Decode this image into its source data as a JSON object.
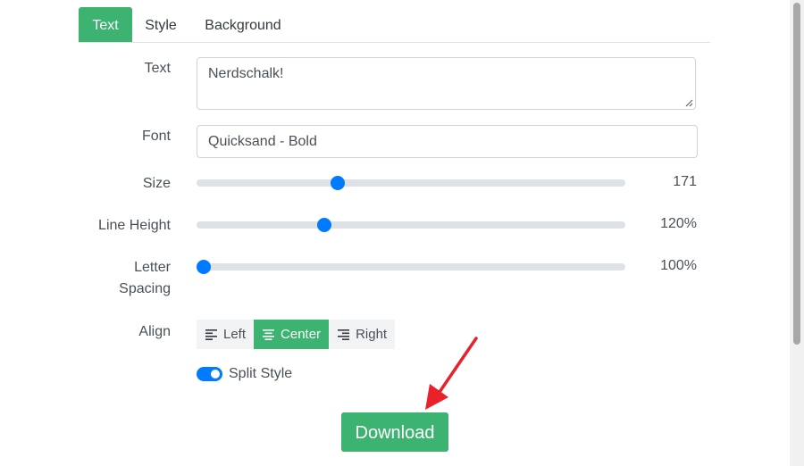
{
  "tabs": [
    {
      "label": "Text",
      "active": true
    },
    {
      "label": "Style",
      "active": false
    },
    {
      "label": "Background",
      "active": false
    }
  ],
  "form": {
    "text": {
      "label": "Text",
      "value": "Nerdschalk!"
    },
    "font": {
      "label": "Font",
      "value": "Quicksand - Bold"
    },
    "size": {
      "label": "Size",
      "value": "171",
      "position_fraction": 0.323
    },
    "line_height": {
      "label": "Line Height",
      "value": "120%",
      "position_fraction": 0.29
    },
    "letter_spacing": {
      "label_line1": "Letter",
      "label_line2": "Spacing",
      "value": "100%",
      "position_fraction": 0.0
    },
    "align": {
      "label": "Align",
      "options": [
        {
          "label": "Left",
          "icon": "align-left-icon",
          "active": false
        },
        {
          "label": "Center",
          "icon": "align-center-icon",
          "active": true
        },
        {
          "label": "Right",
          "icon": "align-right-icon",
          "active": false
        }
      ]
    },
    "split_style": {
      "label": "Split Style",
      "checked": true
    }
  },
  "download_label": "Download",
  "colors": {
    "accent_green": "#3cb371",
    "slider_blue": "#007bff",
    "annotation_arrow": "#e8212a"
  }
}
